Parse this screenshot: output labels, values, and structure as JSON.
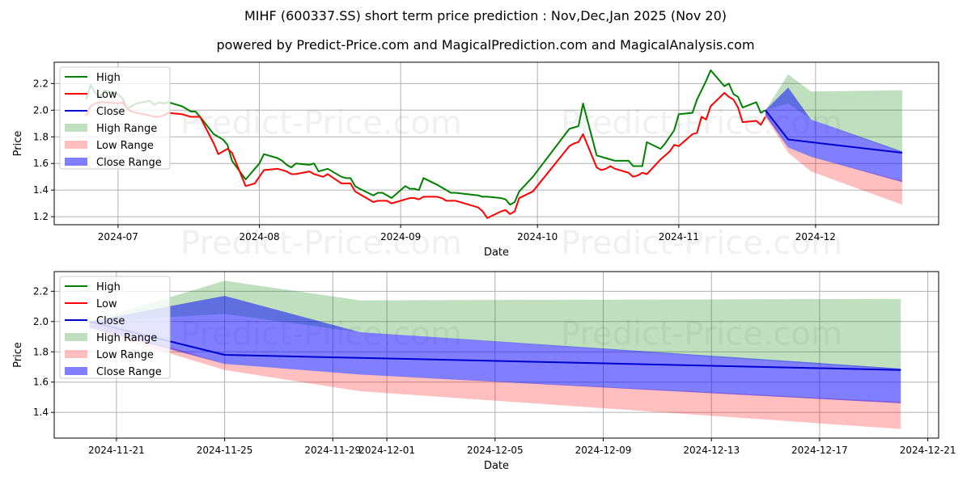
{
  "header": {
    "title": "MIHF (600337.SS) short term price prediction : Nov,Dec,Jan 2025 (Nov 20)",
    "subtitle": "powered by Predict-Price.com and MagicalPrediction.com and MagicalAnalysis.com"
  },
  "watermark": "Predict-Price.com",
  "colors": {
    "high": "#008000",
    "low": "#ff0000",
    "close": "#0000cd",
    "high_range": "#80c080",
    "low_range": "#ff8080",
    "close_range": "#0000ff"
  },
  "legend": [
    "High",
    "Low",
    "Close",
    "High Range",
    "Low Range",
    "Close Range"
  ],
  "chart_data": [
    {
      "type": "line",
      "name": "history-and-forecast",
      "xlabel": "Date",
      "ylabel": "Price",
      "ylim": [
        1.14,
        2.36
      ],
      "xlim": [
        "2024-06-17",
        "2024-12-28"
      ],
      "yticks": [
        1.2,
        1.4,
        1.6,
        1.8,
        2.0,
        2.2
      ],
      "xticks": [
        "2024-07",
        "2024-08",
        "2024-09",
        "2024-10",
        "2024-11",
        "2024-12"
      ],
      "xtick_dates": [
        "2024-07-01",
        "2024-08-01",
        "2024-09-01",
        "2024-10-01",
        "2024-11-01",
        "2024-12-01"
      ],
      "grid": true,
      "legend_position": "top-left",
      "history": {
        "dates": [
          "2024-06-24",
          "2024-06-25",
          "2024-06-26",
          "2024-06-27",
          "2024-06-28",
          "2024-07-01",
          "2024-07-02",
          "2024-07-03",
          "2024-07-04",
          "2024-07-05",
          "2024-07-08",
          "2024-07-09",
          "2024-07-10",
          "2024-07-11",
          "2024-07-12",
          "2024-07-15",
          "2024-07-16",
          "2024-07-17",
          "2024-07-18",
          "2024-07-19",
          "2024-07-22",
          "2024-07-23",
          "2024-07-24",
          "2024-07-25",
          "2024-07-26",
          "2024-07-29",
          "2024-07-30",
          "2024-07-31",
          "2024-08-01",
          "2024-08-02",
          "2024-08-05",
          "2024-08-06",
          "2024-08-07",
          "2024-08-08",
          "2024-08-09",
          "2024-08-12",
          "2024-08-13",
          "2024-08-14",
          "2024-08-15",
          "2024-08-16",
          "2024-08-19",
          "2024-08-20",
          "2024-08-21",
          "2024-08-22",
          "2024-08-23",
          "2024-08-26",
          "2024-08-27",
          "2024-08-28",
          "2024-08-29",
          "2024-08-30",
          "2024-09-02",
          "2024-09-03",
          "2024-09-04",
          "2024-09-05",
          "2024-09-06",
          "2024-09-09",
          "2024-09-10",
          "2024-09-11",
          "2024-09-12",
          "2024-09-13",
          "2024-09-18",
          "2024-09-19",
          "2024-09-20",
          "2024-09-23",
          "2024-09-24",
          "2024-09-25",
          "2024-09-26",
          "2024-09-27",
          "2024-09-30",
          "2024-10-08",
          "2024-10-09",
          "2024-10-10",
          "2024-10-11",
          "2024-10-14",
          "2024-10-15",
          "2024-10-16",
          "2024-10-17",
          "2024-10-18",
          "2024-10-21",
          "2024-10-22",
          "2024-10-23",
          "2024-10-24",
          "2024-10-25",
          "2024-10-28",
          "2024-10-29",
          "2024-10-30",
          "2024-10-31",
          "2024-11-01",
          "2024-11-04",
          "2024-11-05",
          "2024-11-06",
          "2024-11-07",
          "2024-11-08",
          "2024-11-11",
          "2024-11-12",
          "2024-11-13",
          "2024-11-14",
          "2024-11-15",
          "2024-11-18",
          "2024-11-19",
          "2024-11-20"
        ],
        "high": [
          2.08,
          2.19,
          2.13,
          2.1,
          2.15,
          2.12,
          2.09,
          2.01,
          2.03,
          2.05,
          2.07,
          2.04,
          2.06,
          2.05,
          2.06,
          2.03,
          2.01,
          1.99,
          1.99,
          1.95,
          1.82,
          1.8,
          1.78,
          1.74,
          1.62,
          1.48,
          1.52,
          1.56,
          1.6,
          1.67,
          1.64,
          1.62,
          1.59,
          1.57,
          1.6,
          1.59,
          1.6,
          1.54,
          1.55,
          1.56,
          1.5,
          1.49,
          1.49,
          1.43,
          1.41,
          1.36,
          1.38,
          1.38,
          1.36,
          1.34,
          1.43,
          1.41,
          1.41,
          1.4,
          1.49,
          1.44,
          1.42,
          1.4,
          1.38,
          1.38,
          1.36,
          1.35,
          1.35,
          1.34,
          1.33,
          1.29,
          1.31,
          1.39,
          1.5,
          1.86,
          1.87,
          1.88,
          2.05,
          1.66,
          1.65,
          1.64,
          1.63,
          1.62,
          1.62,
          1.58,
          1.58,
          1.58,
          1.76,
          1.71,
          1.75,
          1.8,
          1.85,
          1.97,
          1.98,
          2.08,
          2.15,
          2.22,
          2.3,
          2.18,
          2.2,
          2.12,
          2.1,
          2.02,
          2.06,
          1.98,
          2.0
        ],
        "low": [
          1.96,
          2.03,
          2.05,
          2.06,
          2.06,
          2.05,
          2.06,
          2.01,
          1.99,
          1.98,
          1.96,
          1.95,
          1.95,
          1.96,
          1.98,
          1.97,
          1.96,
          1.95,
          1.95,
          1.95,
          1.75,
          1.67,
          1.69,
          1.71,
          1.68,
          1.43,
          1.44,
          1.45,
          1.5,
          1.55,
          1.56,
          1.55,
          1.54,
          1.52,
          1.52,
          1.54,
          1.52,
          1.51,
          1.5,
          1.52,
          1.45,
          1.45,
          1.45,
          1.39,
          1.37,
          1.31,
          1.32,
          1.32,
          1.32,
          1.3,
          1.33,
          1.34,
          1.34,
          1.33,
          1.35,
          1.35,
          1.34,
          1.32,
          1.32,
          1.32,
          1.27,
          1.24,
          1.19,
          1.24,
          1.25,
          1.22,
          1.24,
          1.34,
          1.39,
          1.73,
          1.75,
          1.76,
          1.82,
          1.57,
          1.55,
          1.56,
          1.58,
          1.56,
          1.53,
          1.5,
          1.51,
          1.53,
          1.52,
          1.63,
          1.66,
          1.69,
          1.74,
          1.73,
          1.82,
          1.83,
          1.95,
          1.93,
          2.03,
          2.13,
          2.1,
          2.08,
          2.02,
          1.91,
          1.92,
          1.89,
          1.95
        ]
      },
      "forecast": {
        "dates": [
          "2024-11-20",
          "2024-11-25",
          "2024-11-30",
          "2024-12-20"
        ],
        "close": [
          2.0,
          1.78,
          1.76,
          1.68
        ],
        "high_range": {
          "upper": [
            2.0,
            2.27,
            2.14,
            2.15
          ],
          "lower": [
            2.0,
            2.05,
            1.93,
            1.68
          ]
        },
        "low_range": {
          "upper": [
            2.0,
            1.72,
            1.65,
            1.47
          ],
          "lower": [
            1.95,
            1.68,
            1.54,
            1.29
          ]
        },
        "close_range": {
          "upper": [
            2.0,
            2.17,
            1.93,
            1.69
          ],
          "lower": [
            1.96,
            1.72,
            1.65,
            1.46
          ]
        }
      }
    },
    {
      "type": "line",
      "name": "forecast-zoom",
      "xlabel": "Date",
      "ylabel": "Price",
      "ylim": [
        1.23,
        2.33
      ],
      "xlim": [
        "2024-11-18.7",
        "2024-12-21.4"
      ],
      "yticks": [
        1.4,
        1.6,
        1.8,
        2.0,
        2.2
      ],
      "xticks": [
        "2024-11-21",
        "2024-11-25",
        "2024-11-29",
        "2024-12-01",
        "2024-12-05",
        "2024-12-09",
        "2024-12-13",
        "2024-12-17",
        "2024-12-21"
      ],
      "grid": true,
      "legend_position": "top-left",
      "forecast": {
        "dates": [
          "2024-11-20",
          "2024-11-25",
          "2024-11-30",
          "2024-12-20"
        ],
        "close": [
          2.0,
          1.78,
          1.76,
          1.68
        ],
        "high_range": {
          "upper": [
            2.0,
            2.27,
            2.14,
            2.15
          ],
          "lower": [
            2.0,
            2.05,
            1.93,
            1.68
          ]
        },
        "low_range": {
          "upper": [
            2.0,
            1.72,
            1.65,
            1.47
          ],
          "lower": [
            1.95,
            1.68,
            1.54,
            1.29
          ]
        },
        "close_range": {
          "upper": [
            2.0,
            2.17,
            1.93,
            1.69
          ],
          "lower": [
            1.96,
            1.72,
            1.65,
            1.46
          ]
        }
      }
    }
  ]
}
